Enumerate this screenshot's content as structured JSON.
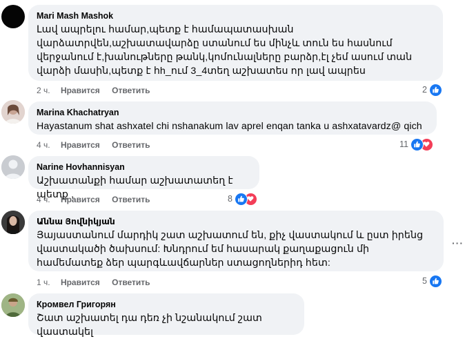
{
  "comments": [
    {
      "author": "Mari Mash Mashok",
      "text": "Լավ ապրելու համար,պետք է համապատասխան վարձատրվեն,աշխատավարձը ստանում ես մինչև տուն ես հասնում վերջանում է,խանութները թանկ,կոմունալները բարձր,էլ չեմ ասում տան վարձի մասին,պետք է հh_ում 3_4տեղ աշխատես որ լավ ապրես",
      "time": "2 ч.",
      "like_label": "Нравится",
      "reply_label": "Ответить",
      "reaction_count": "2"
    },
    {
      "author": "Marina Khachatryan",
      "text": "Hayastanum shat ashxatel chi nshanakum lav aprel enqan tanka u ashxatavardz@ qich",
      "time": "4 ч.",
      "like_label": "Нравится",
      "reply_label": "Ответить",
      "reaction_count": "11"
    },
    {
      "author": "Narine Hovhannisyan",
      "text": "Աշխատանքի համար աշխատատեղ է պետք ,",
      "time": "4 ч.",
      "like_label": "Нравится",
      "reply_label": "Ответить",
      "reaction_count": "8"
    },
    {
      "author": "Աննա Յովնիկյան",
      "text": "Յայաստանում մարդիկ շատ աշխատում են, քիչ վաստակում և ըստ իրենց վաստակածի ծախսում: Խնդրում եմ հասարակ քաղաքացուն մի համեմատեք ձեր պարգևավճարներ ստացողներիդ հետ:",
      "time": "1 ч.",
      "like_label": "Нравится",
      "reply_label": "Ответить",
      "reaction_count": "5"
    },
    {
      "author": "Кромвел Григорян",
      "text": "Շատ աշխատել դա դեռ չի նշանակում շատ վաստակել",
      "time": "",
      "like_label": "",
      "reply_label": "",
      "reaction_count": ""
    }
  ],
  "more_options": "···"
}
